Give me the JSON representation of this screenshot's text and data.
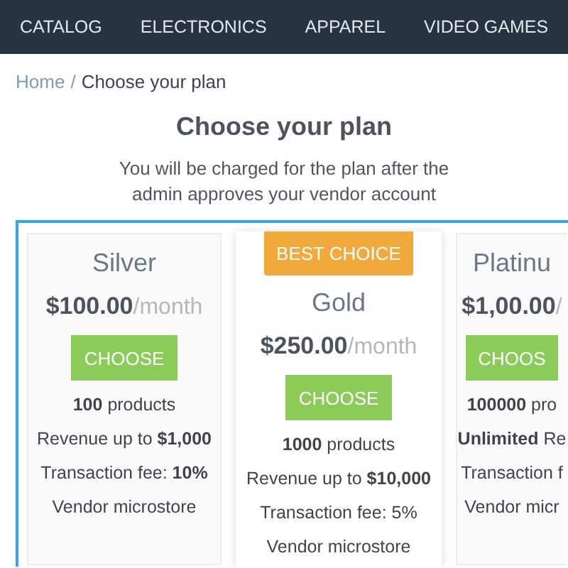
{
  "nav": [
    {
      "label": "CATALOG"
    },
    {
      "label": "ELECTRONICS"
    },
    {
      "label": "APPAREL"
    },
    {
      "label": "VIDEO GAMES"
    }
  ],
  "breadcrumb": {
    "link": "Home",
    "separator": "/",
    "current": "Choose your plan"
  },
  "title": "Choose your plan",
  "subtitle": "You will be charged for the plan after the admin approves your vendor account",
  "plans": [
    {
      "name": "Silver",
      "price": "$100.00",
      "period": "/month",
      "button": "CHOOSE",
      "featured": false,
      "cut": false,
      "features": [
        "**100** products",
        "Revenue up to **$1,000**",
        "Transaction fee: **10%**",
        "Vendor microstore"
      ]
    },
    {
      "name": "Gold",
      "badge": "BEST CHOICE",
      "price": "$250.00",
      "period": "/month",
      "button": "CHOOSE",
      "featured": true,
      "cut": false,
      "features": [
        "**1000** products",
        "Revenue up to **$10,000**",
        "Transaction fee: 5%",
        "Vendor microstore"
      ]
    },
    {
      "name": "Platinu",
      "price": "$1,00.00",
      "period": "/",
      "button": "CHOOS",
      "featured": false,
      "cut": true,
      "features": [
        "**100000** pro",
        "**Unlimited** Re",
        "Transaction f",
        "Vendor micr"
      ]
    }
  ]
}
